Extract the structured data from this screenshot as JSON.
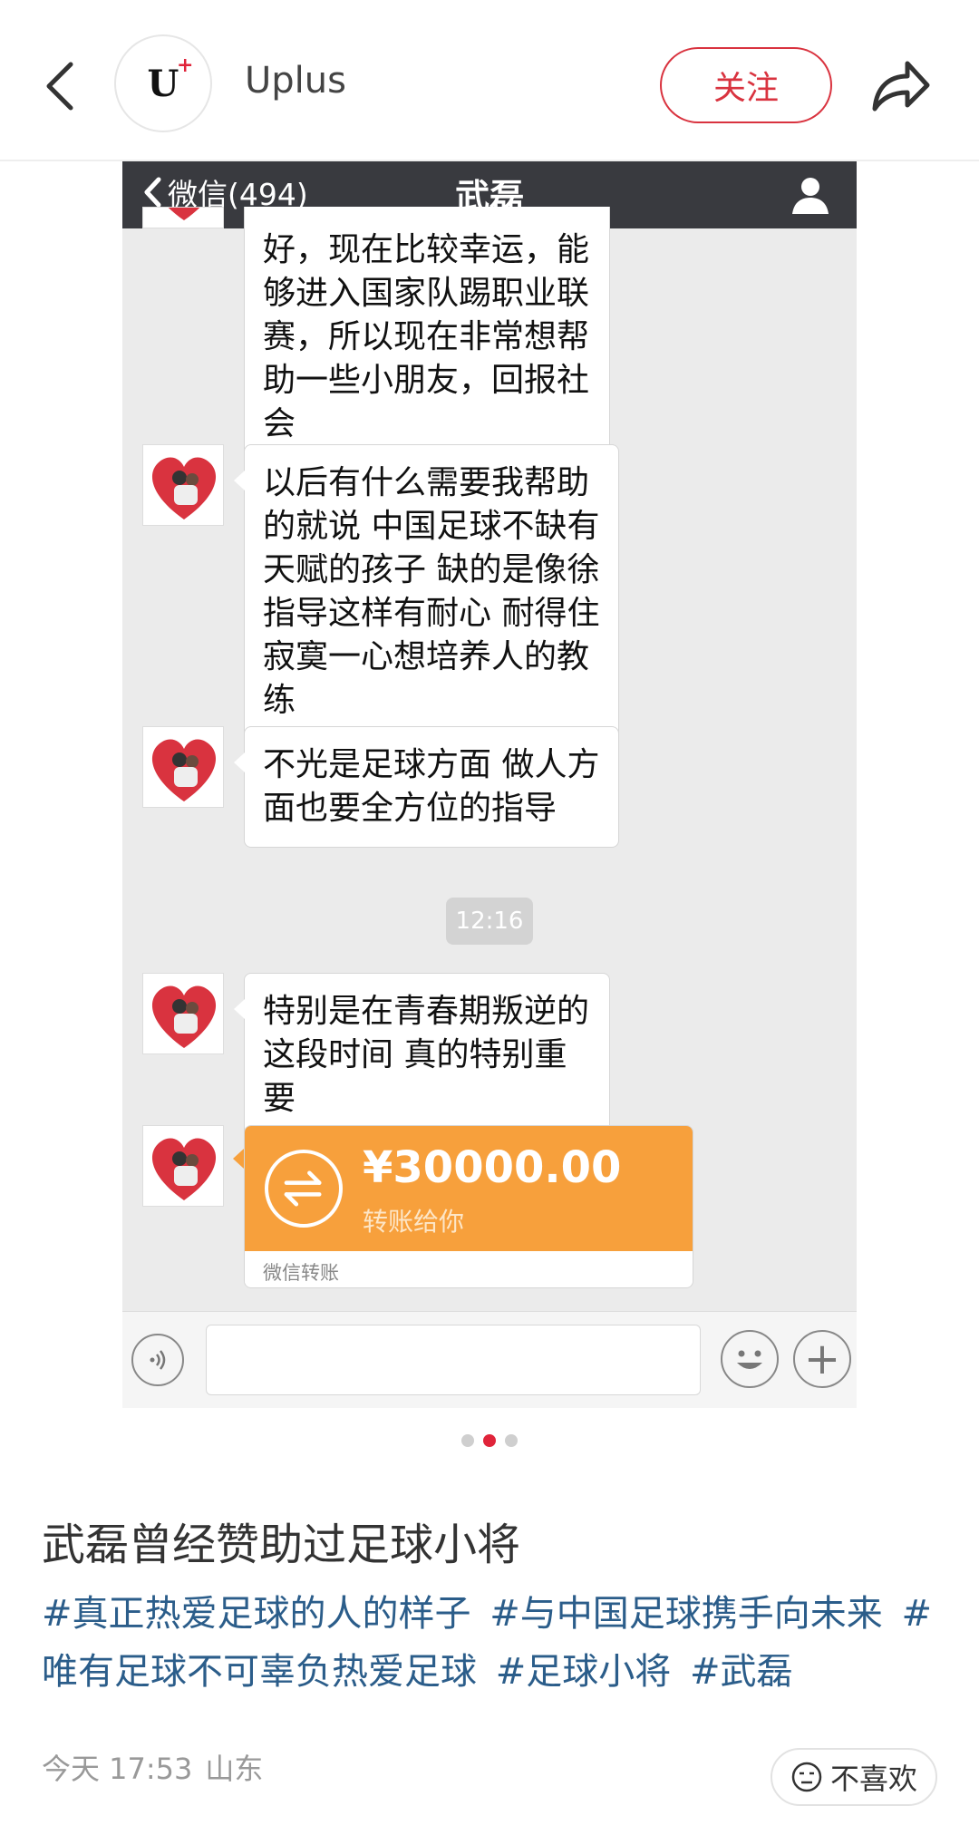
{
  "header": {
    "avatar_text": "U",
    "avatar_plus": "+",
    "username": "Uplus",
    "follow_label": "关注"
  },
  "chat": {
    "back_label": "微信(494)",
    "title": "武磊",
    "messages": [
      "好，现在比较幸运，能够进入国家队踢职业联赛，所以现在非常想帮助一些小朋友，回报社会",
      "以后有什么需要我帮助的就说 中国足球不缺有天赋的孩子 缺的是像徐指导这样有耐心 耐得住寂寞一心想培养人的教练",
      "不光是足球方面 做人方面也要全方位的指导",
      "特别是在青春期叛逆的这段时间 真的特别重要"
    ],
    "time": "12:16",
    "transfer": {
      "amount": "¥30000.00",
      "desc": "转账给你",
      "footer": "微信转账",
      "color": "#f7a03c"
    }
  },
  "carousel": {
    "count": 3,
    "active": 1
  },
  "post": {
    "title": "武磊曾经赞助过足球小将",
    "tags": [
      "#真正热爱足球的人的样子",
      "#与中国足球携手向未来",
      "#唯有足球不可辜负热爱足球",
      "#足球小将",
      "#武磊"
    ],
    "time": "今天 17:53",
    "location": "山东",
    "dislike_label": "不喜欢"
  },
  "colors": {
    "accent": "#d9333f",
    "tag": "#2b5d8a",
    "wechat_bar": "#393a3f"
  }
}
